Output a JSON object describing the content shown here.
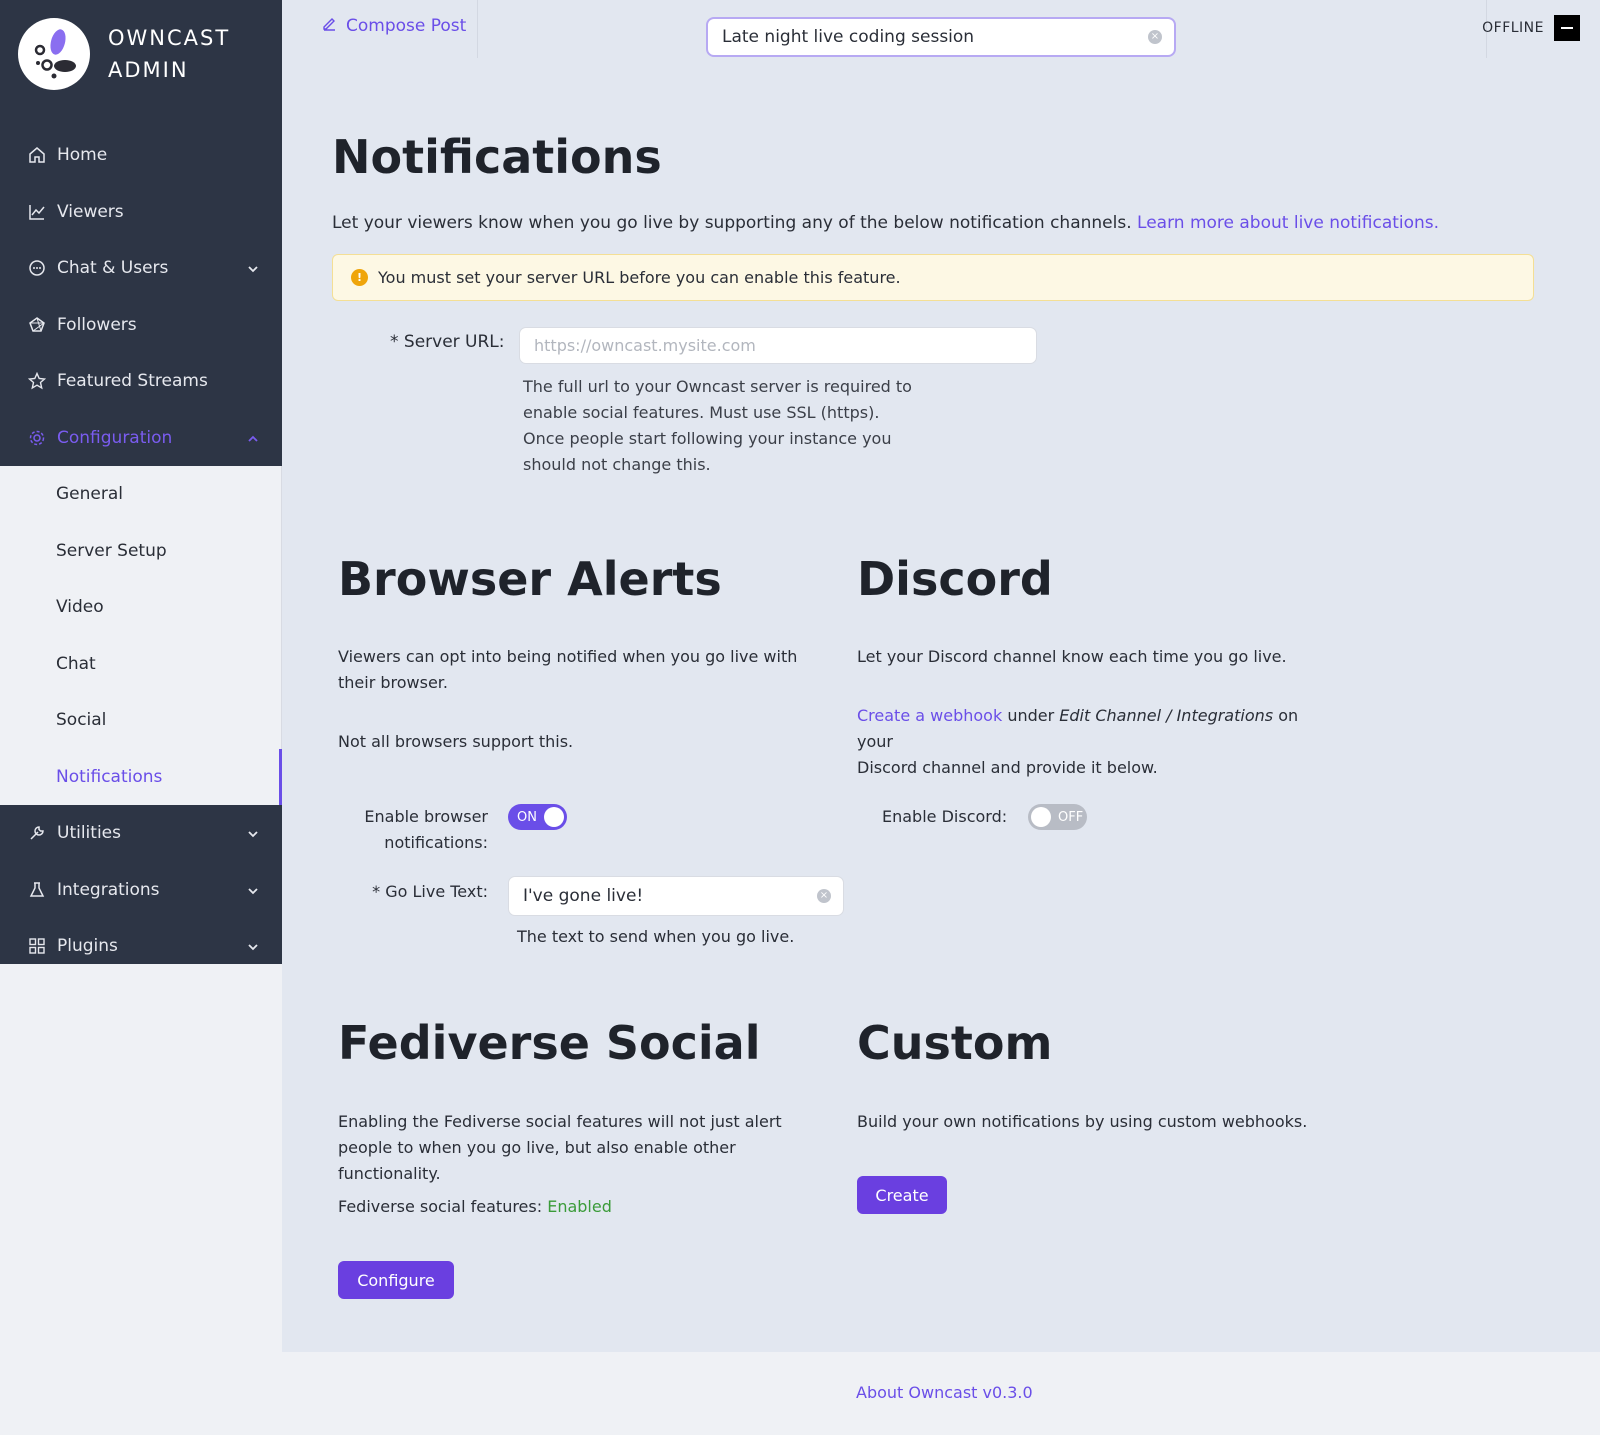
{
  "brand": {
    "line1": "OWNCAST",
    "line2": "ADMIN"
  },
  "sidebar": {
    "items": [
      {
        "label": "Home",
        "icon": "home-icon"
      },
      {
        "label": "Viewers",
        "icon": "line-chart-icon"
      },
      {
        "label": "Chat & Users",
        "icon": "chat-bubble-icon",
        "expandable": true
      },
      {
        "label": "Followers",
        "icon": "fediverse-icon"
      },
      {
        "label": "Featured Streams",
        "icon": "star-icon"
      },
      {
        "label": "Configuration",
        "icon": "gear-icon",
        "expanded": true
      },
      {
        "label": "Utilities",
        "icon": "wrench-icon",
        "expandable": true
      },
      {
        "label": "Integrations",
        "icon": "flask-icon",
        "expandable": true
      },
      {
        "label": "Plugins",
        "icon": "grid-icon",
        "expandable": true
      }
    ],
    "config_submenu": [
      "General",
      "Server Setup",
      "Video",
      "Chat",
      "Social",
      "Notifications"
    ],
    "selected": "Notifications"
  },
  "topbar": {
    "compose_label": "Compose Post",
    "stream_title_value": "Late night live coding session",
    "status_label": "OFFLINE"
  },
  "page": {
    "title": "Notifications",
    "intro_text": "Let your viewers know when you go live by supporting any of the below notification channels.",
    "intro_link": "Learn more about live notifications.",
    "alert_text": "You must set your server URL before you can enable this feature.",
    "server_url_label": "* Server URL:",
    "server_url_placeholder": "https://owncast.mysite.com",
    "server_url_help": "The full url to your Owncast server is required to enable social features. Must use SSL (https). Once people start following your instance you should not change this."
  },
  "browser_alerts": {
    "title": "Browser Alerts",
    "desc1": "Viewers can opt into being notified when you go live with their browser.",
    "desc2": "Not all browsers support this.",
    "enable_label_1": "Enable browser",
    "enable_label_2": "notifications:",
    "toggle_state": "ON",
    "go_live_label": "* Go Live Text:",
    "go_live_value": "I've gone live!",
    "go_live_help": "The text to send when you go live."
  },
  "discord": {
    "title": "Discord",
    "desc1": "Let your Discord channel know each time you go live.",
    "link": "Create a webhook",
    "desc2_a": "under",
    "desc2_em": "Edit Channel / Integrations",
    "desc2_b": "on your",
    "desc2_c": "Discord channel and provide it below.",
    "enable_label": "Enable Discord:",
    "toggle_state": "OFF"
  },
  "fediverse": {
    "title": "Fediverse Social",
    "desc": "Enabling the Fediverse social features will not just alert people to when you go live, but also enable other functionality.",
    "status_label": "Fediverse social features:",
    "status_value": "Enabled",
    "button": "Configure"
  },
  "custom": {
    "title": "Custom",
    "desc": "Build your own notifications by using custom webhooks.",
    "button": "Create"
  },
  "footer": {
    "link": "About Owncast v0.3.0"
  },
  "colors": {
    "accent": "#6a4ee8",
    "sidebar_bg": "#2d3545",
    "main_bg": "#e2e7f0",
    "enabled": "#3a9b38",
    "warning": "#efa50b"
  }
}
